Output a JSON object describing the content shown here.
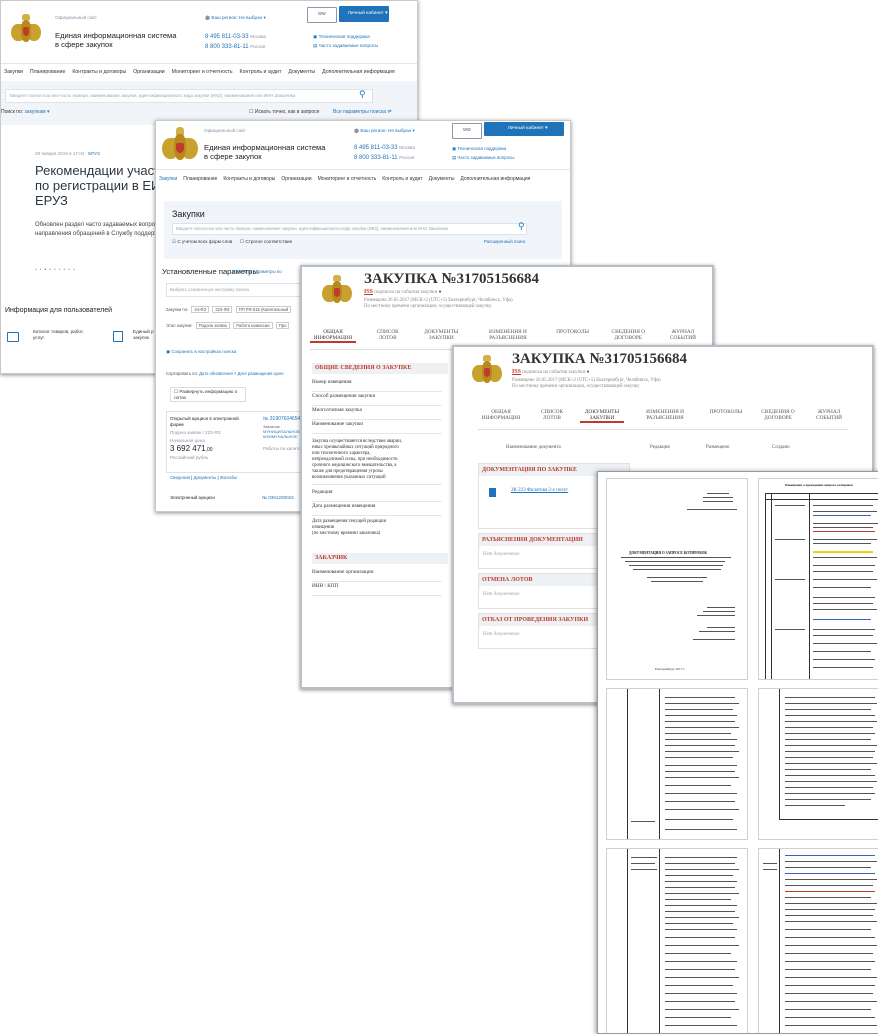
{
  "shot1": {
    "top_label": "Официальный сайт",
    "region_label": "Ваш регион: Не выбран ▾",
    "login_button": "Личный кабинет ▾",
    "site_title_1": "Единая информационная система",
    "site_title_2": "в сфере закупок",
    "phone_1": "8 495 811-03-33",
    "phone_1_note": "Москва",
    "phone_2": "8 800 333-81-11",
    "phone_2_note": "Россия",
    "support_1": "Техническая поддержка",
    "support_2": "Часто задаваемые вопросы",
    "menu": [
      "Закупки",
      "Планирование",
      "Контракты и договоры",
      "Организации",
      "Мониторинг и отчетность",
      "Контроль и аудит",
      "Документы",
      "Дополнительная информация"
    ],
    "search_placeholder": "Введите полностью или часть номера, наименование закупки, идентификационного кода закупки (ИКЗ), наименования или ИНН Заказчика",
    "search_in_label": "Поиск по:",
    "search_in_value": "закупкам ▾",
    "exact_label": "Искать точно, как в запросе",
    "all_params": "Все параметры поиска",
    "news_date": "29 января 2019 в 17:04",
    "news_tag": "ЕРУЗ",
    "news_title_1": "Рекомендации участ",
    "news_title_2": "по регистрации в ЕИС",
    "news_title_3": "ЕРУЗ",
    "news_text_1": "Обновлен раздел часто задаваемых вопросо",
    "news_text_2": "направления обращений в Службу поддержк",
    "users_info": "Информация для пользователей",
    "catalog_1": "Каталог товаров, работ,",
    "catalog_2": "услуг",
    "single_1": "Единый р",
    "single_2": "закупок"
  },
  "shot2": {
    "top_label": "Официальный сайт",
    "region_label": "Ваш регион: Не выбран ▾",
    "login_button": "Личный кабинет ▾",
    "site_title_1": "Единая информационная система",
    "site_title_2": "в сфере закупок",
    "phone_1": "8 495 811-03-33",
    "phone_1_note": "Москва",
    "phone_2": "8 800 333-81-11",
    "phone_2_note": "Россия",
    "support_1": "Техническая поддержка",
    "support_2": "Часто задаваемые вопросы",
    "menu": [
      "Закупки",
      "Планирование",
      "Контракты и договоры",
      "Организации",
      "Мониторинг и отчетность",
      "Контроль и аудит",
      "Документы",
      "Дополнительная информация"
    ],
    "section_title": "Закупки",
    "search_placeholder": "Введите полностью или часть номера, наименование закупки, идентификационного кода закупки (ИКЗ), наименования или ИНН Заказчика",
    "check_1": "С учетом всех форм слов",
    "check_2": "Строгое соответствие",
    "advanced": "Расширенный поиск",
    "params_title": "Установленные параметры",
    "params_link": "Изменить параметры по",
    "saved_placeholder": "Выбрать сохраненную настройку поиска",
    "law_label": "Закупки по:",
    "laws": [
      "44-ФЗ",
      "223-ФЗ",
      "ПП РФ 615 (Капитальный"
    ],
    "stage_label": "Этап закупки:",
    "stages": [
      "Подача заявок",
      "Работа комиссии",
      "Про"
    ],
    "save_settings": "Сохранить в настройках поиска",
    "sort_label": "Сортировать по:",
    "sort_1": "Дате обновления",
    "sort_2": "Дате размещения",
    "sort_3": "Цене",
    "expand": "Развернуть информацию о лотах",
    "card1_type_1": "Открытый аукцион в электронной",
    "card1_type_2": "форме",
    "card1_law": "Подача заявок / 223-ФЗ",
    "card1_price_label": "Начальная цена",
    "card1_price": "3 692 471",
    "card1_price_cents": ",00",
    "card1_currency": "Российский рубль",
    "card1_number": "№ 31907604654",
    "card1_customer_label": "Заказчик:",
    "card1_customer_1": "МУНИЦИПАЛЬНОЕ",
    "card1_customer_2": "КОММУНАЛЬНОЕ",
    "card1_obj": "Работы по капиталь",
    "card1_links": [
      "Сведения",
      "Документы",
      "Жалобы"
    ],
    "card2_type": "Электронный аукцион",
    "card2_number": "№ 0361200015"
  },
  "shot3": {
    "title": "ЗАКУПКА №31705156684",
    "iss": "ISS",
    "subscribe": "подписка на события закупки",
    "placed": "Размещено 26.05.2017 (МСК+2 (UTC+5) Екатеринбург, Челябинск, Уфа)",
    "tz_note": "По местному времени организации, осуществляющей закупку",
    "tabs": [
      "ОБЩАЯ ИНФОРМАЦИЯ",
      "СПИСОК ЛОТОВ",
      "ДОКУМЕНТЫ ЗАКУПКИ",
      "ИЗМЕНЕНИЯ И РАЗЪЯСНЕНИЯ",
      "ПРОТОКОЛЫ",
      "СВЕДЕНИЯ О ДОГОВОРЕ",
      "ЖУРНАЛ СОБЫТИЙ"
    ],
    "section_general": "ОБЩИЕ СВЕДЕНИЯ О ЗАКУПКЕ",
    "rows": [
      "Номер извещения",
      "Способ размещения закупки",
      "Многоэтапная закупка",
      "Наименование закупки"
    ],
    "rule_text": [
      "Закупка осуществляется вследствие аварии,",
      "иных чрезвычайных ситуаций природного",
      "или техногенного характера,",
      "непреодолимой силы, при необходимости",
      "срочного медицинского вмешательства, а",
      "также для предотвращения угрозы",
      "возникновения указанных ситуаций"
    ],
    "rows_2": [
      "Редакция",
      "Дата размещения извещения"
    ],
    "date_edit": [
      "Дата размещения текущей редакции",
      "извещения",
      "(по местному времени заказчика)"
    ],
    "section_customer": "ЗАКАЗЧИК",
    "rows_3": [
      "Наименование организации",
      "ИНН \\ КПП"
    ]
  },
  "shot4": {
    "title": "ЗАКУПКА №31705156684",
    "iss": "ISS",
    "subscribe": "подписка на события закупки",
    "placed": "Размещено 26.05.2017 (МСК+2 (UTC+5) Екатеринбург, Челябинск, Уфа)",
    "tz_note": "По местному времени организации, осуществляющей закупку",
    "tabs": [
      "ОБЩАЯ ИНФОРМАЦИЯ",
      "СПИСОК ЛОТОВ",
      "ДОКУМЕНТЫ ЗАКУПКИ",
      "ИЗМЕНЕНИЯ И РАЗЪЯСНЕНИЯ",
      "ПРОТОКОЛЫ",
      "СВЕДЕНИЯ О ДОГОВОРЕ",
      "ЖУРНАЛ СОБЫТИЙ"
    ],
    "col_name": "Наименование документа",
    "col_edition": "Редакция",
    "col_placed": "Размещено",
    "col_created": "Создано",
    "sec_docs": "ДОКУМЕНТАЦИЯ ПО ЗАКУПКЕ",
    "doc_file": "ЗК 223 Филатова 2-е полуг",
    "sec_clar": "РАЗЪЯСНЕНИЯ ДОКУМЕНТАЦИИ",
    "no_docs": "Нет документов",
    "sec_cancel_lots": "ОТМЕНА ЛОТОВ",
    "sec_refuse": "ОТКАЗ ОТ ПРОВЕДЕНИЯ ЗАКУПКИ"
  },
  "shot5": {
    "doc_heading": "ДОКУМЕНТАЦИЯ О ЗАПРОСЕ КОТИРОВОК",
    "table_title": "Извещение о проведении запроса котировок",
    "city": "Екатеринбург 2017 г."
  }
}
